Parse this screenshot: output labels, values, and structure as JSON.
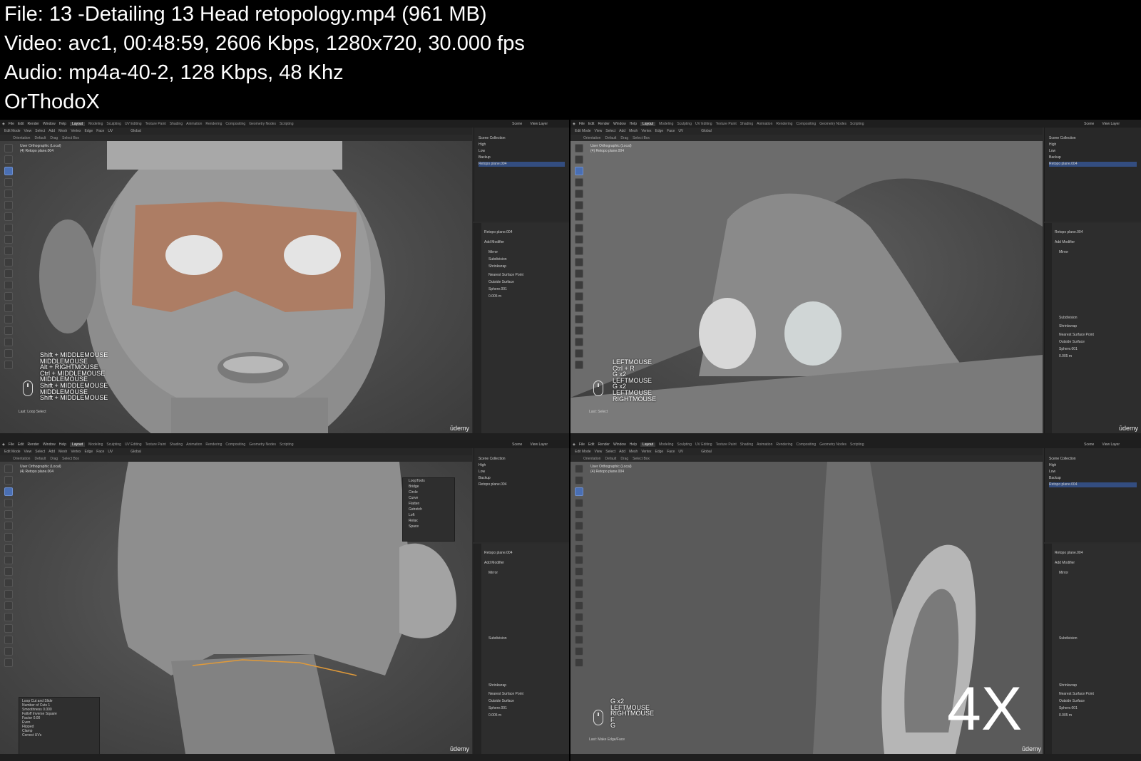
{
  "header": {
    "file_line": "File: 13 -Detailing 13 Head retopology.mp4 (961 MB)",
    "video_line": "Video: avc1, 00:48:59, 2606 Kbps, 1280x720, 30.000 fps",
    "audio_line": "Audio: mp4a-40-2, 128 Kbps, 48 Khz",
    "uploader": "OrThodoX"
  },
  "blender": {
    "menu_items": [
      "File",
      "Edit",
      "Render",
      "Window",
      "Help"
    ],
    "workspaces": [
      "Layout",
      "Modeling",
      "Sculpting",
      "UV Editing",
      "Texture Paint",
      "Shading",
      "Animation",
      "Rendering",
      "Compositing",
      "Geometry Nodes",
      "Scripting"
    ],
    "mode": "Edit Mode",
    "header_items": [
      "View",
      "Select",
      "Add",
      "Mesh",
      "Vertex",
      "Edge",
      "Face",
      "UV"
    ],
    "transform_orientation": "Global",
    "toolbar3_items": [
      "Orientation",
      "Default",
      "Drag",
      "Select Box"
    ],
    "scene": "Scene",
    "view_layer": "View Layer",
    "outliner": [
      "Scene Collection",
      "High",
      "Low",
      "Backup",
      "Retopo plane.004"
    ],
    "viewport_label_1": "User Orthographic (Local)",
    "viewport_label_2": "(4) Retopo plane.004",
    "modifier_object": "Retopo plane.004",
    "modifier_shrinkwrap": "Shrinkwrap",
    "add_modifier": "Add Modifier",
    "modifiers": [
      "Mirror",
      "Subdivision",
      "Shrinkwrap"
    ],
    "wrap_method": "Nearest Surface Point",
    "snap_mode": "Outside Surface",
    "target": "Sphere.001",
    "offset": "0.005 m",
    "udemy": "ūdemy"
  },
  "frames": [
    {
      "shortcuts": "Shift + MIDDLEMOUSE\nMIDDLEMOUSE\nAlt + RIGHTMOUSE\nCtrl + MIDDLEMOUSE\nMIDDLEMOUSE\nShift + MIDDLEMOUSE\nMIDDLEMOUSE\nShift + MIDDLEMOUSE",
      "last_op": "Last: Loop Select"
    },
    {
      "shortcuts": "LEFTMOUSE\nCtrl + R\nG x2\nLEFTMOUSE\nG x2\nLEFTMOUSE\nRIGHTMOUSE",
      "last_op": "Last: Select"
    },
    {
      "shortcuts": "",
      "last_op": "",
      "loopcut_title": "Loop Cut and Slide",
      "loopcut_rows": [
        "Number of Cuts",
        "Smoothness",
        "Falloff",
        "Factor"
      ],
      "loopcut_values": [
        "1",
        "0.000",
        "Inverse Square",
        "0.00"
      ],
      "loopcut_checks": [
        "Even",
        "Flipped",
        "Clamp",
        "Correct UVs"
      ],
      "n_panel_title": "LoopTools",
      "n_panel_items": [
        "Bridge",
        "Circle",
        "Curve",
        "Flatten",
        "Gstretch",
        "Loft",
        "Relax",
        "Space"
      ]
    },
    {
      "shortcuts": "G x2\nLEFTMOUSE\nRIGHTMOUSE\nF\nG",
      "last_op": "Last: Make Edge/Face",
      "speed_label": "4X"
    }
  ]
}
